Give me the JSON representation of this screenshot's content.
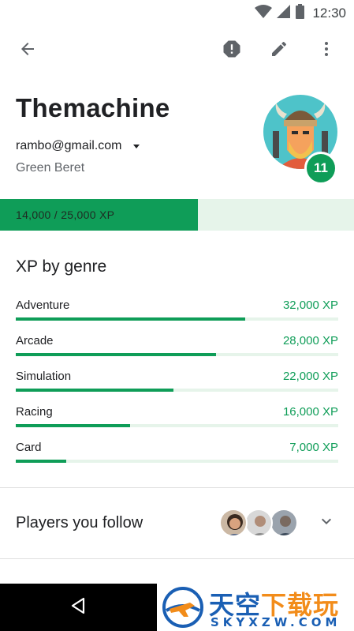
{
  "status_bar": {
    "time": "12:30",
    "icons": [
      "wifi-icon",
      "signal-icon",
      "battery-icon"
    ]
  },
  "toolbar": {
    "icons": [
      "back-arrow-icon",
      "report-icon",
      "edit-pencil-icon",
      "more-vert-icon"
    ]
  },
  "profile": {
    "name": "Themachine",
    "email": "rambo@gmail.com",
    "player_title": "Green Beret",
    "level": "11",
    "avatar": "viking-avatar"
  },
  "xp": {
    "label": "14,000 / 25,000 XP",
    "current": 14000,
    "max": 25000
  },
  "genres": {
    "title": "XP by genre",
    "scale_max": 45000,
    "items": [
      {
        "name": "Adventure",
        "xp_label": "32,000 XP",
        "xp": 32000
      },
      {
        "name": "Arcade",
        "xp_label": "28,000 XP",
        "xp": 28000
      },
      {
        "name": "Simulation",
        "xp_label": "22,000 XP",
        "xp": 22000
      },
      {
        "name": "Racing",
        "xp_label": "16,000 XP",
        "xp": 16000
      },
      {
        "name": "Card",
        "xp_label": "7,000 XP",
        "xp": 7000
      }
    ]
  },
  "following": {
    "title": "Players you follow",
    "avatars": [
      "player-avatar-1",
      "player-avatar-2",
      "player-avatar-3"
    ]
  },
  "nav": {
    "icons": [
      "nav-back-icon"
    ]
  },
  "watermark": {
    "cn_blue": "天空",
    "cn_orange": "下载玩",
    "en": "SKYXZW.COM"
  },
  "colors": {
    "accent": "#0f9d58",
    "accent_light": "#e6f4ea",
    "text": "#202124",
    "secondary_text": "#5f6368"
  }
}
